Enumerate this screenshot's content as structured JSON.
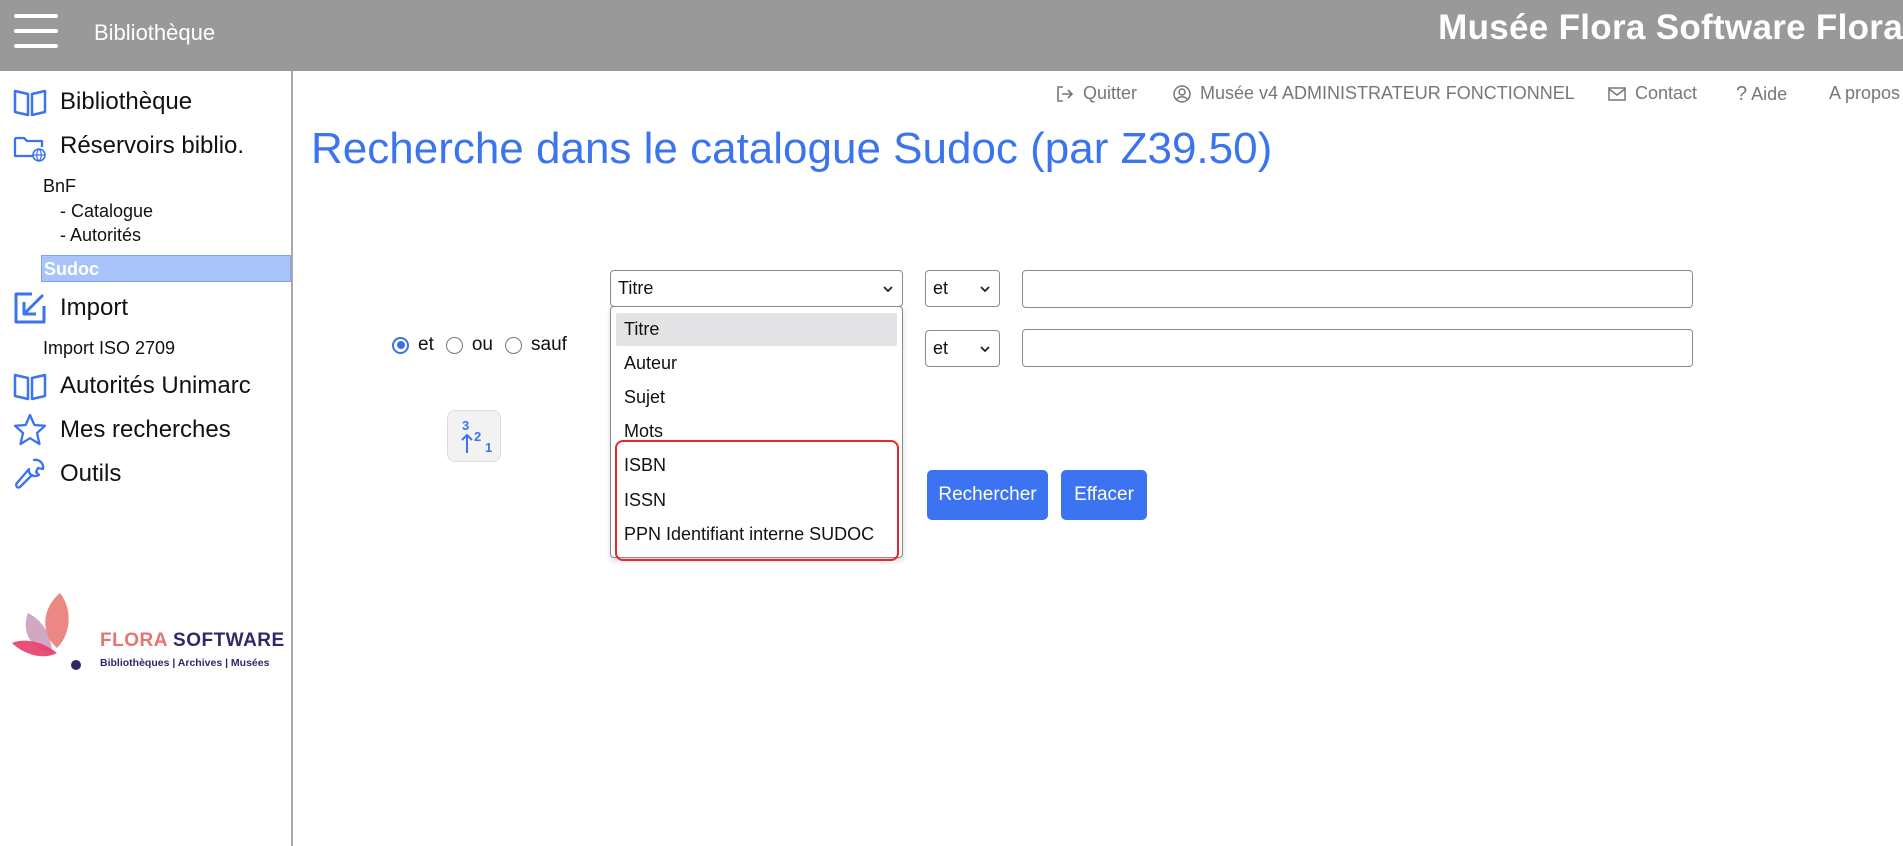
{
  "header": {
    "section": "Bibliothèque",
    "app_title": "Musée Flora Software Flora",
    "menu_icon": "hamburger-menu-icon"
  },
  "sidebar": {
    "items": [
      {
        "label": "Bibliothèque",
        "icon": "open-book-icon"
      },
      {
        "label": "Réservoirs biblio.",
        "icon": "globe-folder-icon"
      },
      {
        "label": "Import",
        "icon": "import-arrow-icon"
      },
      {
        "label": "Autorités Unimarc",
        "icon": "open-book-icon"
      },
      {
        "label": "Mes recherches",
        "icon": "star-icon"
      },
      {
        "label": "Outils",
        "icon": "wrench-icon"
      }
    ],
    "reservoirs": {
      "bnf": "BnF",
      "catalogue": "- Catalogue",
      "autorites": "- Autorités",
      "sudoc": "Sudoc"
    },
    "import_sub": "Import ISO 2709",
    "logo": {
      "name_part1": "FLORA",
      "name_part2": "SOFTWARE",
      "tagline": "Bibliothèques | Archives | Musées"
    }
  },
  "toplinks": {
    "quit": "Quitter",
    "user": "Musée v4 ADMINISTRATEUR FONCTIONNEL",
    "contact": "Contact",
    "help": "Aide",
    "about": "A propos"
  },
  "main": {
    "title": "Recherche dans le catalogue Sudoc (par Z39.50)"
  },
  "form": {
    "field1_value": "Titre",
    "op1_value": "et",
    "op2_value": "et",
    "dropdown_options": [
      "Titre",
      "Auteur",
      "Sujet",
      "Mots",
      "ISBN",
      "ISSN",
      "PPN Identifiant interne SUDOC"
    ],
    "dropdown_selected": "Titre",
    "radios": [
      {
        "label": "et",
        "checked": true
      },
      {
        "label": "ou",
        "checked": false
      },
      {
        "label": "sauf",
        "checked": false
      }
    ],
    "search_button": "Rechercher",
    "clear_button": "Effacer",
    "sort_icon": "sort-numeric-icon"
  },
  "colors": {
    "accent": "#3b73f0",
    "title": "#3c74ee",
    "topbar": "#999999",
    "highlight": "#e8262c"
  }
}
